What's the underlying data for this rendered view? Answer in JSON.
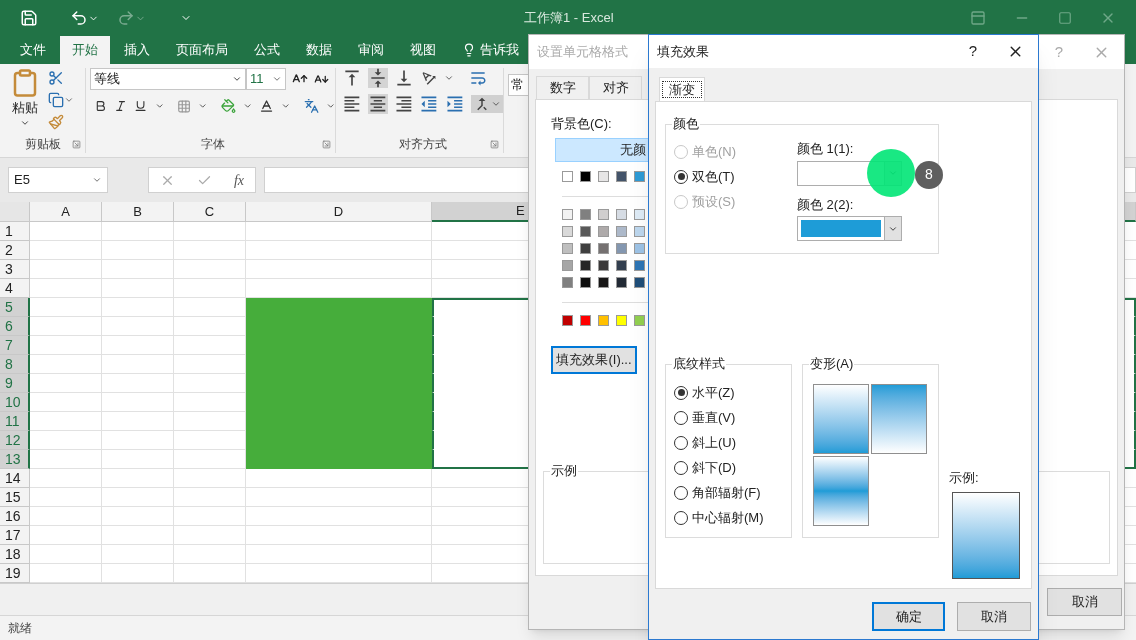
{
  "excel": {
    "title": "工作簿1 - Excel",
    "menu_tabs": [
      {
        "label": "文件",
        "selected": false
      },
      {
        "label": "开始",
        "selected": true
      },
      {
        "label": "插入",
        "selected": false
      },
      {
        "label": "页面布局",
        "selected": false
      },
      {
        "label": "公式",
        "selected": false
      },
      {
        "label": "数据",
        "selected": false
      },
      {
        "label": "审阅",
        "selected": false
      },
      {
        "label": "视图",
        "selected": false
      }
    ],
    "tell_me": "告诉我",
    "ribbon": {
      "paste_label": "粘贴",
      "font_name": "等线",
      "font_size": "11",
      "number_format": "常",
      "groups": [
        "剪贴板",
        "字体",
        "对齐方式"
      ]
    },
    "name_box": "E5",
    "fx": "fx",
    "columns": [
      {
        "label": "A",
        "selected": false
      },
      {
        "label": "B",
        "selected": false
      },
      {
        "label": "C",
        "selected": false
      },
      {
        "label": "D",
        "selected": false
      },
      {
        "label": "E",
        "selected": true
      }
    ],
    "rows": [
      {
        "label": "1",
        "selected": false,
        "d_filled": false
      },
      {
        "label": "2",
        "selected": false,
        "d_filled": false
      },
      {
        "label": "3",
        "selected": false,
        "d_filled": false
      },
      {
        "label": "4",
        "selected": false,
        "d_filled": false
      },
      {
        "label": "5",
        "selected": true,
        "d_filled": true
      },
      {
        "label": "6",
        "selected": true,
        "d_filled": true
      },
      {
        "label": "7",
        "selected": true,
        "d_filled": true
      },
      {
        "label": "8",
        "selected": true,
        "d_filled": true
      },
      {
        "label": "9",
        "selected": true,
        "d_filled": true
      },
      {
        "label": "10",
        "selected": true,
        "d_filled": true
      },
      {
        "label": "11",
        "selected": true,
        "d_filled": true
      },
      {
        "label": "12",
        "selected": true,
        "d_filled": true
      },
      {
        "label": "13",
        "selected": true,
        "d_filled": true
      },
      {
        "label": "14",
        "selected": false,
        "d_filled": false
      },
      {
        "label": "15",
        "selected": false,
        "d_filled": false
      },
      {
        "label": "16",
        "selected": false,
        "d_filled": false
      },
      {
        "label": "17",
        "selected": false,
        "d_filled": false
      },
      {
        "label": "18",
        "selected": false,
        "d_filled": false
      },
      {
        "label": "19",
        "selected": false,
        "d_filled": false
      }
    ],
    "status": "就绪"
  },
  "format_dialog": {
    "title": "设置单元格格式",
    "help": "?",
    "tabs": [
      {
        "label": "数字",
        "selected": false
      },
      {
        "label": "对齐",
        "selected": false
      }
    ],
    "background_label": "背景色(C):",
    "no_color_button": "无颜",
    "swatch_rows": [
      [
        {
          "color": "#ffffff"
        },
        {
          "color": "#000000"
        },
        {
          "color": "#e7e6e6"
        },
        {
          "color": "#44546a"
        },
        {
          "color": "#2e9bd6"
        }
      ],
      [
        {
          "color": "#f2f2f2"
        },
        {
          "color": "#808080"
        },
        {
          "color": "#d0cece"
        },
        {
          "color": "#d6dce4"
        },
        {
          "color": "#deebf6"
        }
      ],
      [
        {
          "color": "#d9d9d9"
        },
        {
          "color": "#595959"
        },
        {
          "color": "#aeaaaa"
        },
        {
          "color": "#adb9ca"
        },
        {
          "color": "#bdd7ee"
        }
      ],
      [
        {
          "color": "#bfbfbf"
        },
        {
          "color": "#404040"
        },
        {
          "color": "#757171"
        },
        {
          "color": "#8497b0"
        },
        {
          "color": "#9dc3e6"
        }
      ],
      [
        {
          "color": "#a6a6a6"
        },
        {
          "color": "#262626"
        },
        {
          "color": "#3a3838"
        },
        {
          "color": "#333f4f"
        },
        {
          "color": "#2e75b5"
        }
      ],
      [
        {
          "color": "#808080"
        },
        {
          "color": "#0d0d0d"
        },
        {
          "color": "#171616"
        },
        {
          "color": "#222a35"
        },
        {
          "color": "#1f4e79"
        }
      ],
      [
        {
          "color": "#c00000"
        },
        {
          "color": "#ff0000"
        },
        {
          "color": "#ffc000"
        },
        {
          "color": "#ffff00"
        },
        {
          "color": "#92d050"
        }
      ]
    ],
    "fill_effects_button": "填充效果(I)...",
    "sample_label": "示例",
    "cancel_button": "取消"
  },
  "fill_dialog": {
    "title": "填充效果",
    "help": "?",
    "tabs": [
      {
        "label": "渐变",
        "selected": true
      }
    ],
    "colors_group": "颜色",
    "color_options": [
      {
        "label": "单色(N)",
        "selected": false,
        "disabled": true
      },
      {
        "label": "双色(T)",
        "selected": true,
        "disabled": false
      },
      {
        "label": "预设(S)",
        "selected": false,
        "disabled": true
      }
    ],
    "color1": {
      "label": "颜色 1(1):"
    },
    "color2": {
      "label": "颜色 2(2):",
      "color": "#1e9cd7"
    },
    "step_badge": "8",
    "shading_group": "底纹样式",
    "shading_options": [
      {
        "label": "水平(Z)",
        "selected": true
      },
      {
        "label": "垂直(V)",
        "selected": false
      },
      {
        "label": "斜上(U)",
        "selected": false
      },
      {
        "label": "斜下(D)",
        "selected": false
      },
      {
        "label": "角部辐射(F)",
        "selected": false
      },
      {
        "label": "中心辐射(M)",
        "selected": false
      }
    ],
    "variants_group": "变形(A)",
    "variants": [
      {
        "kind": "dark-bottom"
      },
      {
        "kind": "dark-top"
      },
      {
        "kind": "dark-middle"
      }
    ],
    "sample_label": "示例:",
    "ok_button": "确定",
    "cancel_button": "取消"
  }
}
